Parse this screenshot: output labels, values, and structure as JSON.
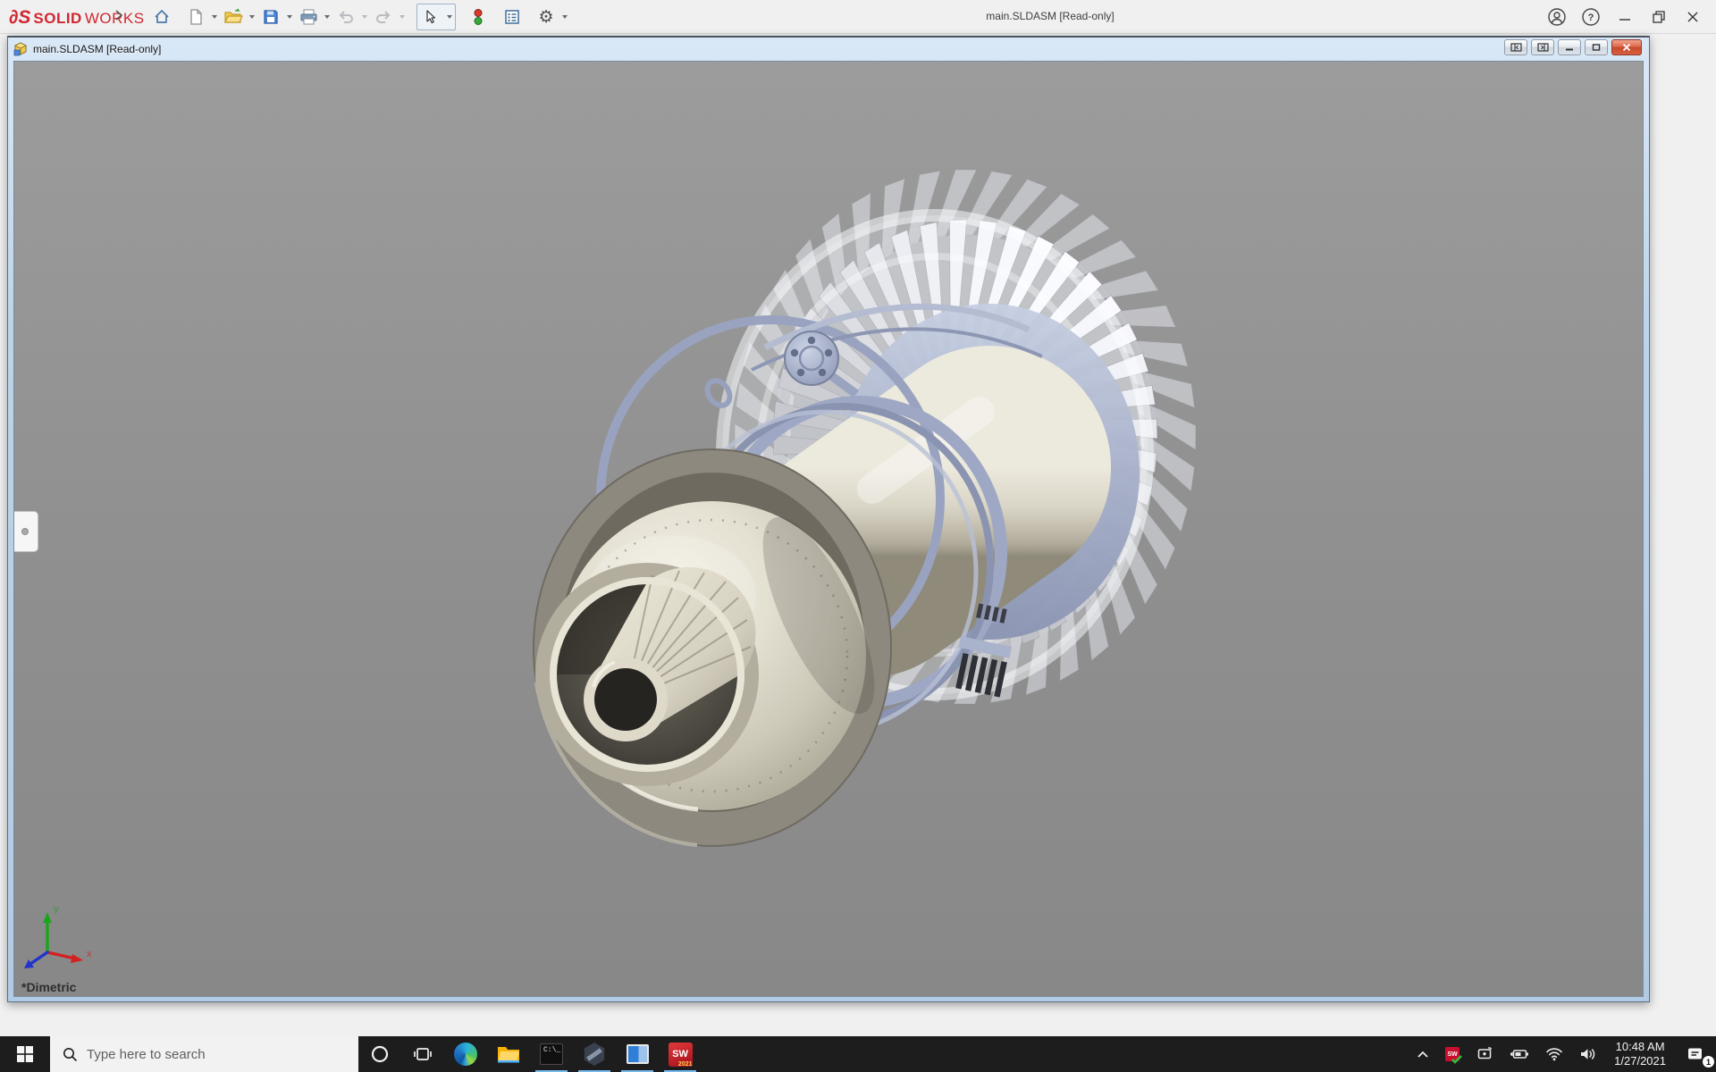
{
  "app_titlebar": {
    "brand_glyph": "∂S",
    "brand_solid": "SOLID",
    "brand_works": "WORKS",
    "title": "main.SLDASM [Read-only]",
    "help_glyph": "?"
  },
  "toolbar_items": [
    "home",
    "new-document",
    "open",
    "save",
    "print",
    "undo",
    "redo",
    "select",
    "rebuild",
    "file-properties",
    "options"
  ],
  "document_window": {
    "title": "main.SLDASM [Read-only]",
    "view_orientation": "*Dimetric",
    "triad_x_label": "x",
    "triad_y_label": "y"
  },
  "taskbar": {
    "search_placeholder": "Type here to search",
    "cmd_text": "C:\\",
    "sw_text": "SW",
    "sw_year": "2021",
    "tray_time": "10:48 AM",
    "tray_date": "1/27/2021",
    "notification_badge": "1"
  },
  "colors": {
    "solidworks_red": "#d22630",
    "doc_titlebar_blue": "#bcd4ea",
    "viewport_gray": "#8f8f8f",
    "taskbar_dark": "#1d1d1d",
    "running_indicator": "#76b9ed",
    "engine_cream": "#d8d3c4",
    "engine_steel_blue": "#a3adc8",
    "engine_taupe": "#8e897e"
  }
}
